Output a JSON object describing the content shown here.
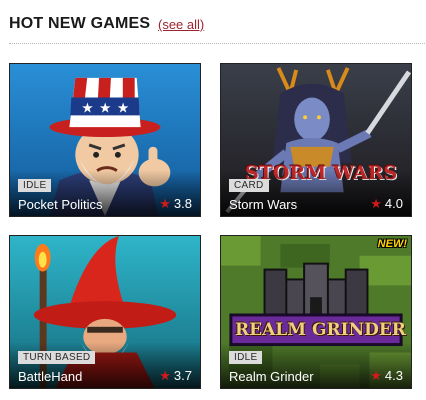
{
  "header": {
    "title": "HOT NEW GAMES",
    "see_all": "(see all)"
  },
  "games": [
    {
      "title": "Pocket Politics",
      "genre": "IDLE",
      "rating": "3.8",
      "icon": "star-icon",
      "art": "uncle-sam-pointing"
    },
    {
      "title": "Storm Wars",
      "genre": "CARD",
      "rating": "4.0",
      "icon": "star-icon",
      "art": "warrior-woman-with-sword",
      "logo": "STORM WARS"
    },
    {
      "title": "BattleHand",
      "genre": "TURN BASED",
      "rating": "3.7",
      "icon": "star-icon",
      "art": "red-hat-wizard"
    },
    {
      "title": "Realm Grinder",
      "genre": "IDLE",
      "rating": "4.3",
      "icon": "star-icon",
      "art": "castle-logo",
      "logo": "REALM GRINDER",
      "badge": "NEW!"
    }
  ],
  "colors": {
    "link": "#9b2430",
    "star": "#d21a1a",
    "tag_bg": "#dcdcdc",
    "badge": "#ffd400"
  }
}
